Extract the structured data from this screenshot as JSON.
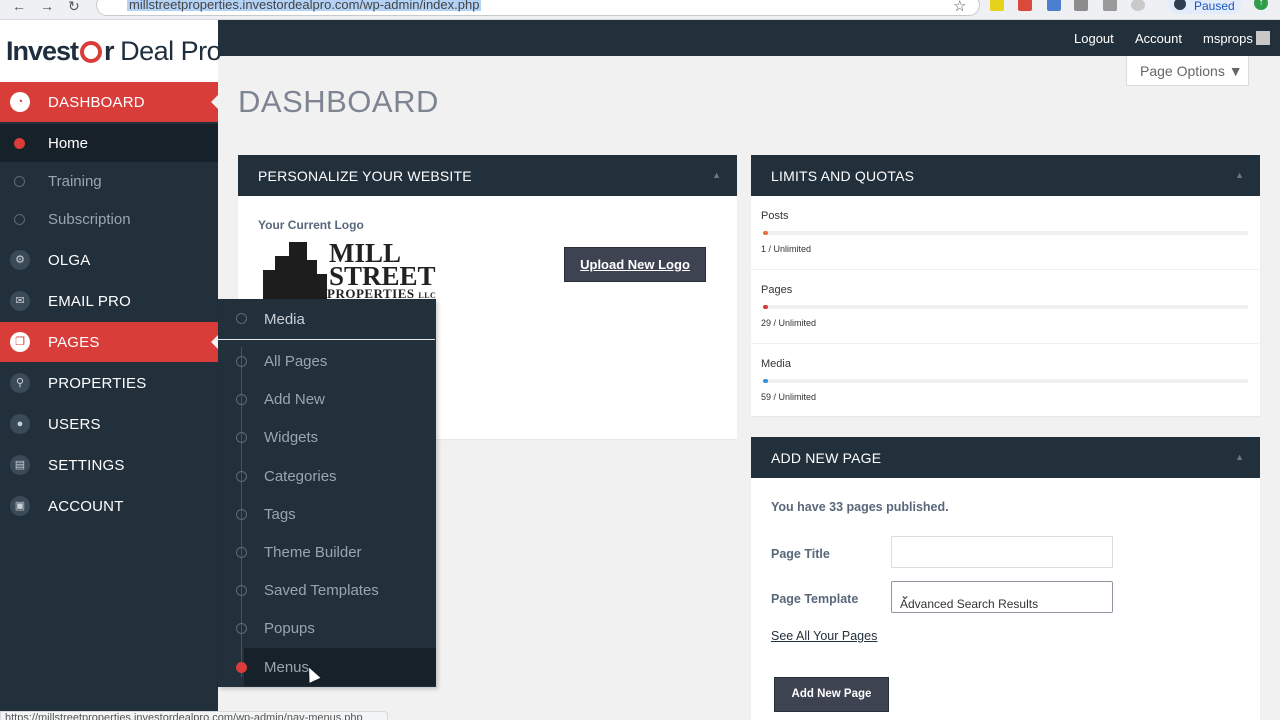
{
  "browser": {
    "url": "millstreetproperties.investordealpro.com/wp-admin/index.php",
    "profile_status": "Paused",
    "status_url": "https://millstreetproperties.investordealpro.com/wp-admin/nav-menus.php"
  },
  "brand": {
    "part1": "Invest",
    "part2": "r",
    "part3": "Deal Pro"
  },
  "topbar": {
    "logout": "Logout",
    "account": "Account",
    "username": "msprops"
  },
  "sidebar": {
    "dashboard": "DASHBOARD",
    "home": "Home",
    "training": "Training",
    "subscription": "Subscription",
    "olga": "OLGA",
    "email_pro": "EMAIL PRO",
    "pages": "PAGES",
    "properties": "PROPERTIES",
    "users": "USERS",
    "settings": "SETTINGS",
    "account": "ACCOUNT"
  },
  "flyout": {
    "media": "Media",
    "all_pages": "All Pages",
    "add_new": "Add New",
    "widgets": "Widgets",
    "categories": "Categories",
    "tags": "Tags",
    "theme_builder": "Theme Builder",
    "saved_templates": "Saved Templates",
    "popups": "Popups",
    "menus": "Menus"
  },
  "main": {
    "title": "DASHBOARD",
    "page_options": "Page Options ▼"
  },
  "personalize": {
    "title": "PERSONALIZE YOUR WEBSITE",
    "current_logo": "Your Current Logo",
    "logo_line1": "MILL",
    "logo_line2": "STREET",
    "logo_line3": "PROPERTIES",
    "logo_llc": "LLC",
    "upload_button": "Upload New Logo"
  },
  "limits": {
    "title": "LIMITS AND QUOTAS",
    "items": [
      {
        "label": "Posts",
        "value": "1 / Unlimited",
        "fill": 0.01,
        "color": "#e8733a"
      },
      {
        "label": "Pages",
        "value": "29 / Unlimited",
        "fill": 0.01,
        "color": "#d93d3a"
      },
      {
        "label": "Media",
        "value": "59 / Unlimited",
        "fill": 0.01,
        "color": "#3b8ed8"
      }
    ]
  },
  "add_page": {
    "title": "ADD NEW PAGE",
    "published": "You have 33 pages published.",
    "page_title_label": "Page Title",
    "page_title_value": "",
    "template_label": "Page Template",
    "template_value": "Advanced Search Results",
    "see_all": "See All Your Pages",
    "button": "Add New Page"
  },
  "colors": {
    "accent": "#d93d3a",
    "sidebar": "#22303c"
  }
}
